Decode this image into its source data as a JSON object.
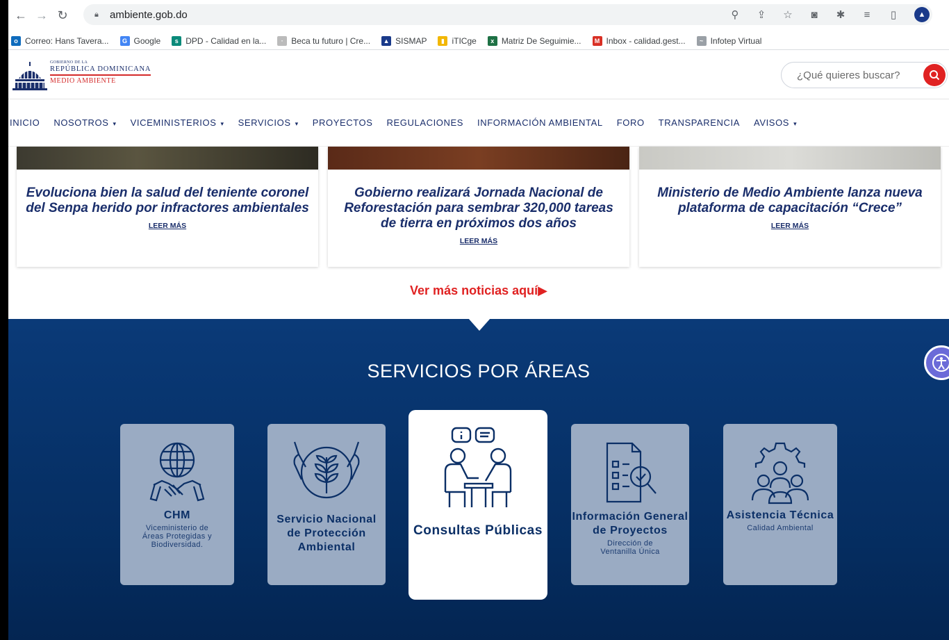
{
  "browser": {
    "url": "ambiente.gob.do",
    "bookmarks": [
      {
        "label": "Correo: Hans Tavera...",
        "color": "#0f6cbd",
        "glyph": "o"
      },
      {
        "label": "Google",
        "color": "#4285f4",
        "glyph": "G"
      },
      {
        "label": "DPD - Calidad en la...",
        "color": "#0b8a7a",
        "glyph": "s"
      },
      {
        "label": "Beca tu futuro | Cre...",
        "color": "#bbbbbb",
        "glyph": "·"
      },
      {
        "label": "SISMAP",
        "color": "#1a3a8a",
        "glyph": "▲"
      },
      {
        "label": "iTICge",
        "color": "#f2b705",
        "glyph": "▮"
      },
      {
        "label": "Matriz De Seguimie...",
        "color": "#1e7145",
        "glyph": "x"
      },
      {
        "label": "Inbox - calidad.gest...",
        "color": "#d93025",
        "glyph": "M"
      },
      {
        "label": "Infotep Virtual",
        "color": "#9aa0a6",
        "glyph": "~"
      }
    ]
  },
  "site": {
    "logo_small": "GOBIERNO DE LA",
    "logo_main": "REPÚBLICA DOMINICANA",
    "logo_sub": "MEDIO AMBIENTE",
    "search_placeholder": "¿Qué quieres buscar?"
  },
  "nav": {
    "items": [
      {
        "label": "INICIO",
        "dropdown": false
      },
      {
        "label": "NOSOTROS",
        "dropdown": true
      },
      {
        "label": "VICEMINISTERIOS",
        "dropdown": true
      },
      {
        "label": "SERVICIOS",
        "dropdown": true
      },
      {
        "label": "PROYECTOS",
        "dropdown": false
      },
      {
        "label": "REGULACIONES",
        "dropdown": false
      },
      {
        "label": "INFORMACIÓN AMBIENTAL",
        "dropdown": false
      },
      {
        "label": "FORO",
        "dropdown": false
      },
      {
        "label": "TRANSPARENCIA",
        "dropdown": false
      },
      {
        "label": "AVISOS",
        "dropdown": true
      }
    ]
  },
  "news": {
    "cards": [
      {
        "title": "Evoluciona bien la salud del teniente coronel del Senpa herido por infractores ambientales",
        "link": "LEER MÁS"
      },
      {
        "title": "Gobierno realizará Jornada Nacional de Reforestación para sembrar 320,000 tareas de tierra en próximos dos años",
        "link": "LEER MÁS"
      },
      {
        "title": "Ministerio de Medio Ambiente lanza nueva plataforma de capacitación “Crece”",
        "link": "LEER MÁS"
      }
    ],
    "more": "Ver más noticias aquí▶"
  },
  "services": {
    "title": "SERVICIOS POR ÁREAS",
    "cards": [
      {
        "title": "CHM",
        "subtitle": "Viceministerio de Áreas Protegidas y Biodiversidad.",
        "icon": "globe-handshake-icon"
      },
      {
        "title": "Servicio Nacional de Protección Ambiental",
        "subtitle": "",
        "icon": "hands-plant-icon"
      },
      {
        "title": "Consultas Públicas",
        "subtitle": "",
        "icon": "meeting-chat-icon"
      },
      {
        "title": "Información General de Proyectos",
        "subtitle": "Dirección de Ventanilla Única",
        "icon": "document-search-icon"
      },
      {
        "title": "Asistencia Técnica",
        "subtitle": "Calidad Ambiental",
        "icon": "gear-people-icon"
      }
    ]
  }
}
